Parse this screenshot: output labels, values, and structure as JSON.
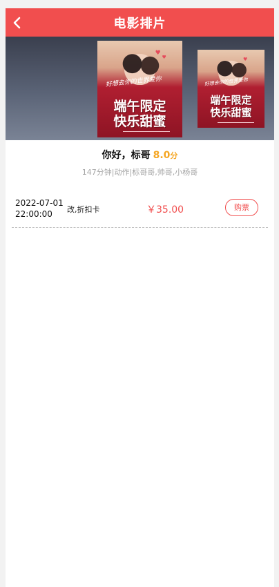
{
  "header": {
    "title": "电影排片",
    "back_icon": "chevron-left-icon"
  },
  "banner": {
    "posters": [
      {
        "tagline": "好想去你的世界爱你",
        "line1": "端午限定",
        "line2": "快乐甜蜜"
      },
      {
        "tagline": "好想去你的世界爱你",
        "line1": "端午限定",
        "line2": "快乐甜蜜"
      }
    ]
  },
  "movie": {
    "title": "你好，标哥",
    "score": "8.0",
    "score_unit": "分",
    "meta": "147分钟|动作|标哥哥,帅哥,小杨哥"
  },
  "schedules": [
    {
      "date": "2022-07-01",
      "time": "22:00:00",
      "type": "改,折扣卡",
      "price": "￥35.00",
      "buy_label": "购票"
    }
  ],
  "colors": {
    "accent": "#f14e4e",
    "score": "#f5a623"
  }
}
